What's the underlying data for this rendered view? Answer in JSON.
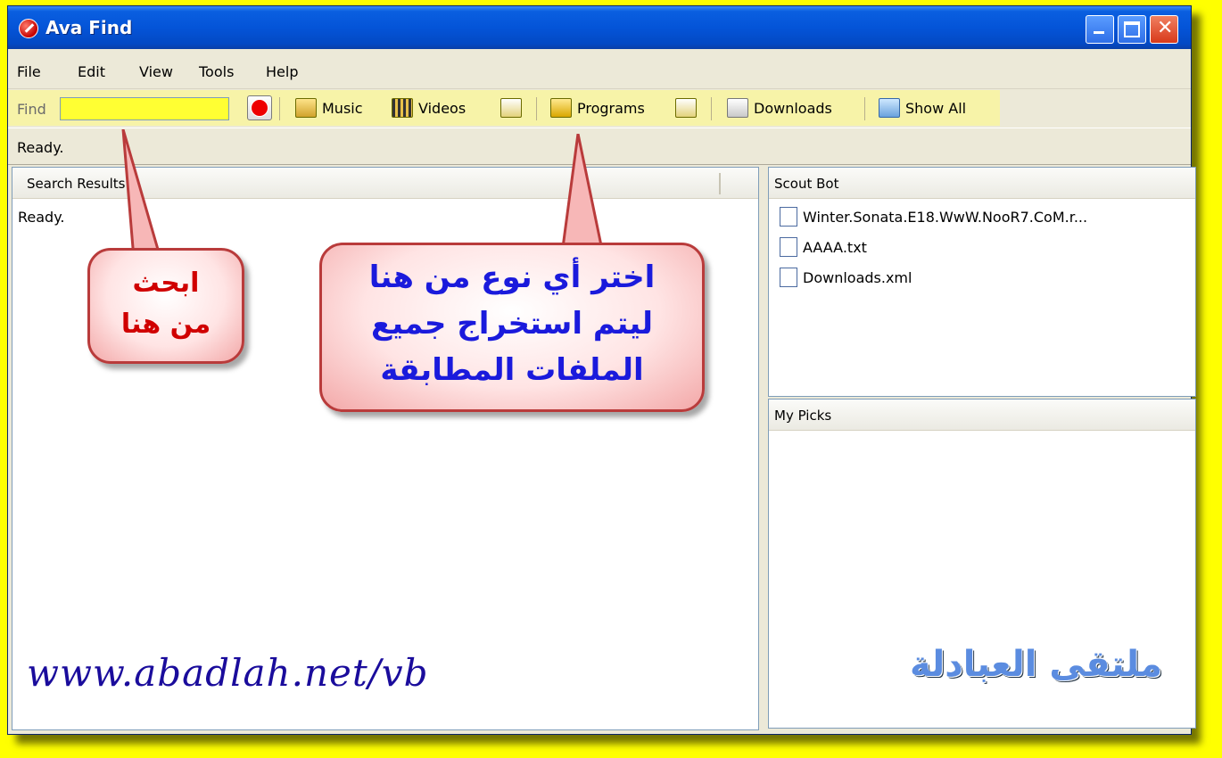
{
  "window": {
    "title": "Ava Find"
  },
  "menu": [
    "File",
    "Edit",
    "View",
    "Tools",
    "Help"
  ],
  "toolbar": {
    "find_label": "Find",
    "find_value": "",
    "buttons": [
      "Music",
      "Videos",
      "Programs",
      "Downloads",
      "Show All"
    ]
  },
  "status": "Ready.",
  "left_pane": {
    "header": "Search Results",
    "text": "Ready."
  },
  "scout_bot": {
    "header": "Scout Bot",
    "files": [
      "Winter.Sonata.E18.WwW.NooR7.CoM.r...",
      "AAAA.txt",
      "Downloads.xml"
    ]
  },
  "my_picks": {
    "header": "My Picks"
  },
  "annotations": {
    "search_hint": [
      "ابحث",
      "من هنا"
    ],
    "category_hint": [
      "اختر أي نوع من هنا",
      "ليتم استخراج جميع",
      "الملفات المطابقة"
    ]
  },
  "watermark": {
    "url": "www.abadlah.net/vb",
    "logo_text": "ملتقى العبادلة"
  },
  "colors": {
    "background": "#ffff00",
    "titlebar": "#0454d8",
    "search_field": "#ffff33",
    "callout_blue": "#1a1adc",
    "callout_red": "#d00000"
  }
}
